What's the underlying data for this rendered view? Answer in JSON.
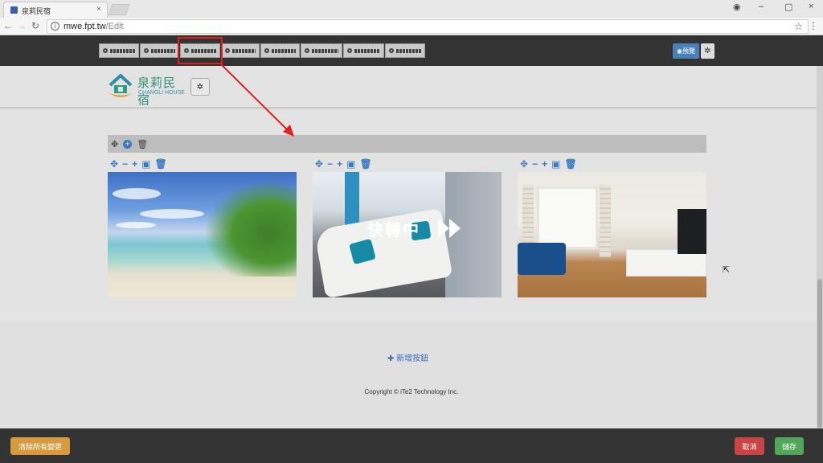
{
  "browser": {
    "tab_title": "泉莉民宿",
    "tab_close": "×",
    "url_host": "mwe.fpt.tw",
    "url_path": "/Edit",
    "win_controls": [
      "–",
      "▢",
      "×"
    ]
  },
  "toolbar": {
    "buttons": [
      "",
      "",
      "",
      "",
      "",
      "",
      "",
      ""
    ],
    "preview_label": "預覽",
    "gear_icon": "gear-icon"
  },
  "site": {
    "logo_cn": "泉莉民宿",
    "logo_en": "CHANGLI HOUSE"
  },
  "gallery": {
    "overlay_text": "快轉中",
    "photos": [
      {
        "subject": "beach"
      },
      {
        "subject": "white sofa"
      },
      {
        "subject": "living room"
      }
    ]
  },
  "footer": {
    "add_button_label": "新增按鈕",
    "copyright": "Copyright © iTe2 Technology Inc."
  },
  "actions": {
    "discard_label": "清除所有變更",
    "cancel_label": "取消",
    "save_label": "儲存"
  },
  "colors": {
    "accent": "#3a7bc0",
    "highlight": "#e02020",
    "save": "#52a65a",
    "cancel": "#c94444",
    "discard": "#d79a40"
  }
}
